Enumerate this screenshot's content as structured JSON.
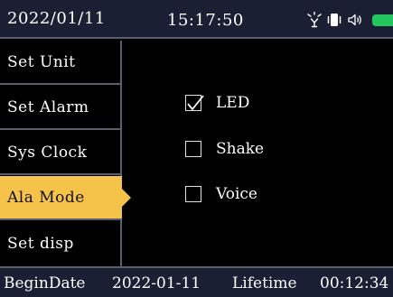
{
  "status": {
    "date": "2022/01/11",
    "time": "15:17:50",
    "icons": [
      "light-bulb-icon",
      "vibrate-icon",
      "speaker-icon",
      "battery-icon"
    ],
    "battery_color": "#22c55e"
  },
  "menu": {
    "items": [
      {
        "label": "Set Unit"
      },
      {
        "label": "Set Alarm"
      },
      {
        "label": "Sys Clock"
      },
      {
        "label": "Ala Mode"
      },
      {
        "label": "Set disp"
      }
    ],
    "selected": "Ala Mode",
    "highlight_color": "#f5c24a"
  },
  "options": [
    {
      "label": "LED",
      "checked": true
    },
    {
      "label": "Shake",
      "checked": false
    },
    {
      "label": "Voice",
      "checked": false
    }
  ],
  "footer": {
    "begin_label": "BeginDate",
    "begin_value": "2022-01-11",
    "lifetime_label": "Lifetime",
    "lifetime_value": "00:12:34"
  }
}
